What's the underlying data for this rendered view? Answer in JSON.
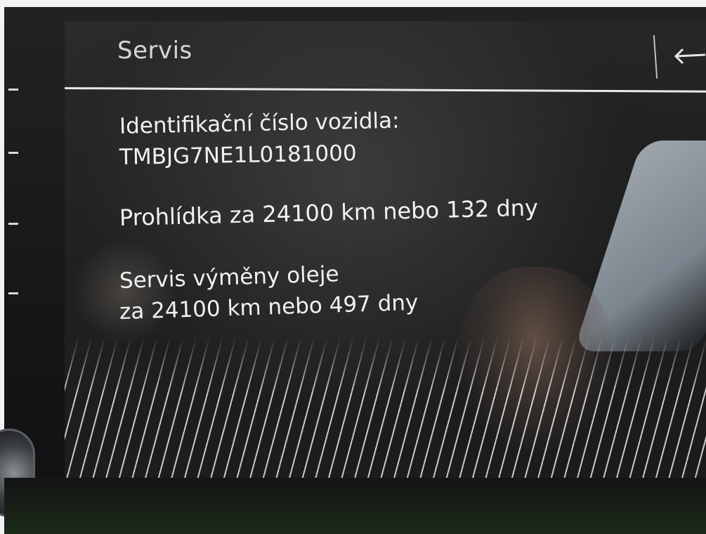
{
  "screen": {
    "title": "Servis",
    "back_icon": "back-arrow-icon"
  },
  "vehicle": {
    "vin_label": "Identifikační číslo vozidla:",
    "vin_value": "TMBJG7NE1L0181000"
  },
  "inspection": {
    "text": "Prohlídka za 24100 km nebo 132 dny"
  },
  "oil_service": {
    "title": "Servis výměny oleje",
    "detail": "za 24100 km nebo 497 dny"
  },
  "colors": {
    "text": "#f1f1f1",
    "divider": "#e8e8e8",
    "background": "#1f2021"
  }
}
